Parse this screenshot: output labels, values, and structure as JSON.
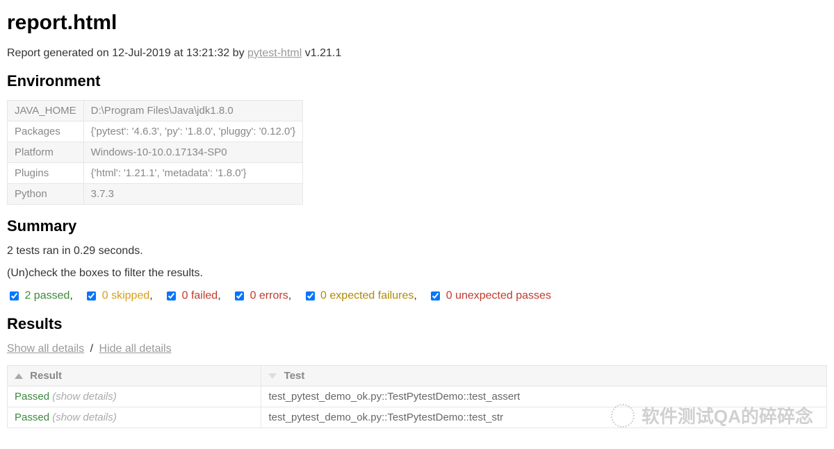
{
  "title": "report.html",
  "generated": {
    "prefix": "Report generated on ",
    "date": "12-Jul-2019",
    "at": " at ",
    "time": "13:21:32",
    "by": " by ",
    "tool_name": "pytest-html",
    "version": " v1.21.1"
  },
  "sections": {
    "environment": "Environment",
    "summary": "Summary",
    "results": "Results"
  },
  "environment": [
    {
      "key": "JAVA_HOME",
      "value": "D:\\Program Files\\Java\\jdk1.8.0"
    },
    {
      "key": "Packages",
      "value": "{'pytest': '4.6.3', 'py': '1.8.0', 'pluggy': '0.12.0'}"
    },
    {
      "key": "Platform",
      "value": "Windows-10-10.0.17134-SP0"
    },
    {
      "key": "Plugins",
      "value": "{'html': '1.21.1', 'metadata': '1.8.0'}"
    },
    {
      "key": "Python",
      "value": "3.7.3"
    }
  ],
  "summary": {
    "run_line": "2 tests ran in 0.29 seconds.",
    "filter_hint": "(Un)check the boxes to filter the results.",
    "filters": {
      "passed": "2 passed",
      "skipped": "0 skipped",
      "failed": "0 failed",
      "errors": "0 errors",
      "expected_failures": "0 expected failures",
      "unexpected_passes": "0 unexpected passes"
    }
  },
  "detail_links": {
    "show_all": "Show all details",
    "hide_all": "Hide all details"
  },
  "results_table": {
    "headers": {
      "result": "Result",
      "test": "Test"
    },
    "show_details_label": "(show details)",
    "rows": [
      {
        "result": "Passed",
        "test": "test_pytest_demo_ok.py::TestPytestDemo::test_assert"
      },
      {
        "result": "Passed",
        "test": "test_pytest_demo_ok.py::TestPytestDemo::test_str"
      }
    ]
  },
  "watermark": "软件测试QA的碎碎念"
}
